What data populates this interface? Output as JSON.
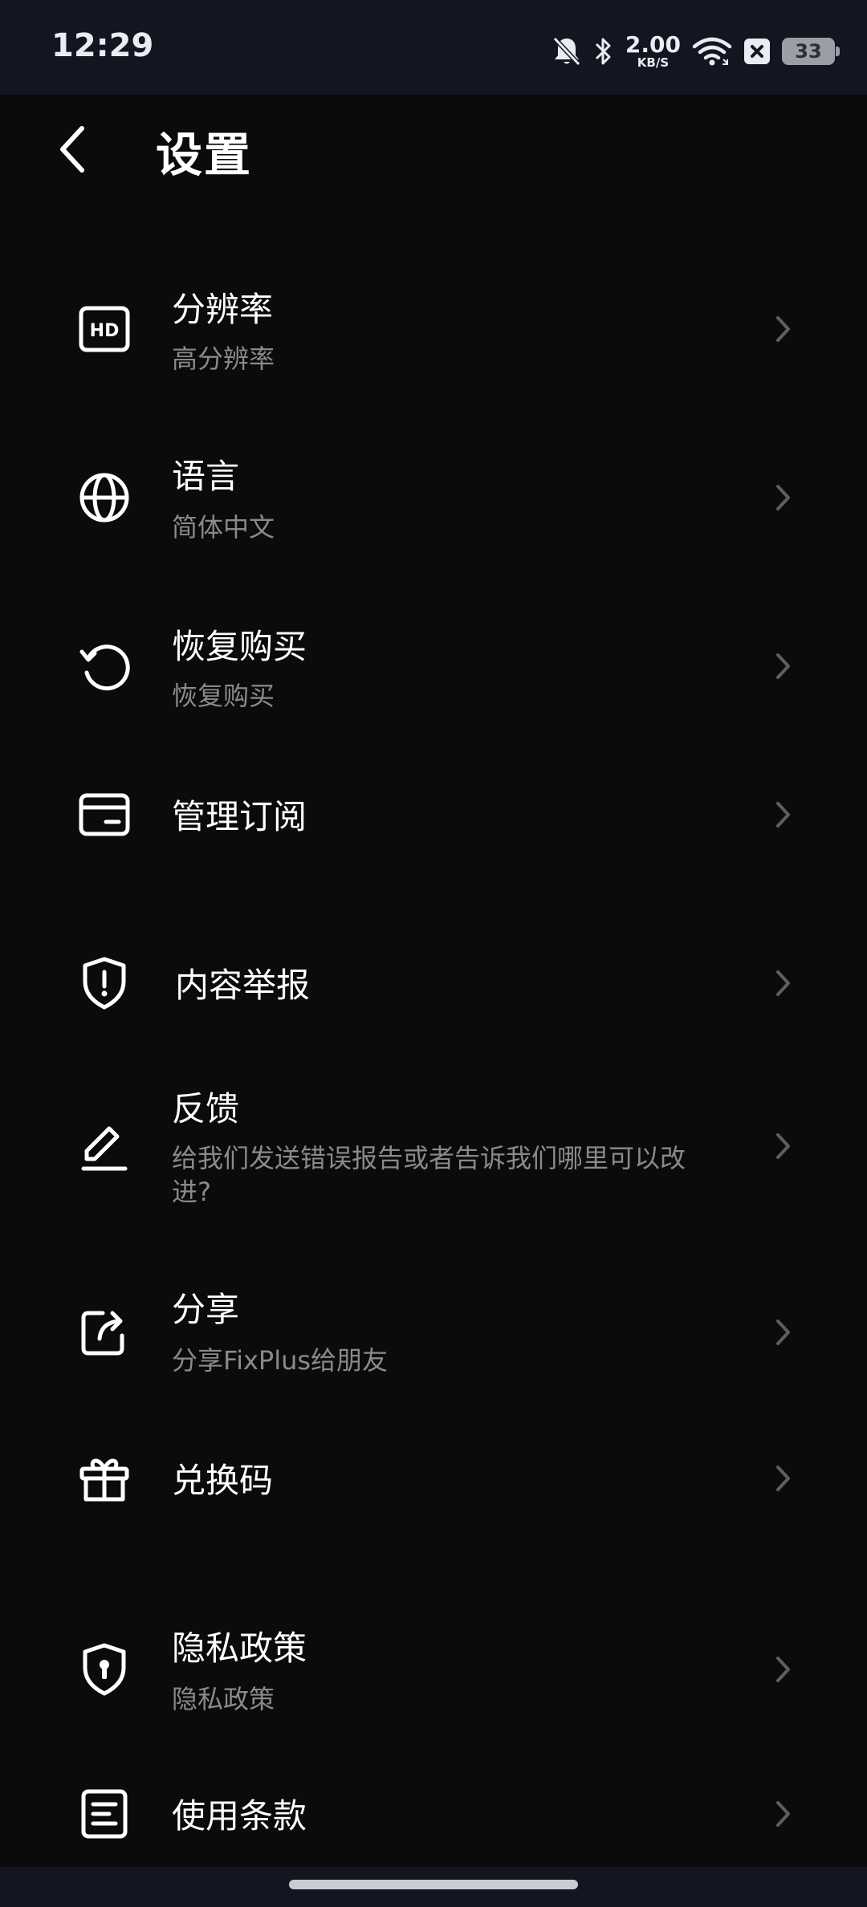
{
  "status_bar": {
    "time": "12:29",
    "net_speed_value": "2.00",
    "net_speed_unit": "KB/S",
    "battery_level": "33",
    "icons": [
      "bell-muted-icon",
      "bluetooth-icon",
      "wifi-icon",
      "close-box-icon",
      "battery-icon"
    ]
  },
  "header": {
    "title": "设置",
    "back_icon": "chevron-left-icon"
  },
  "settings": [
    {
      "label": "分辨率",
      "sub": "高分辨率",
      "icon": "hd-icon"
    },
    {
      "label": "语言",
      "sub": "简体中文",
      "icon": "globe-icon"
    },
    {
      "label": "恢复购买",
      "sub": "恢复购买",
      "icon": "restore-icon"
    },
    {
      "label": "管理订阅",
      "sub": "",
      "icon": "card-icon"
    },
    {
      "label": "内容举报",
      "sub": "",
      "icon": "shield-alert-icon"
    },
    {
      "label": "反馈",
      "sub": "给我们发送错误报告或者告诉我们哪里可以改进?",
      "icon": "pencil-icon"
    },
    {
      "label": "分享",
      "sub": "分享FixPlus给朋友",
      "icon": "share-icon"
    },
    {
      "label": "兑换码",
      "sub": "",
      "icon": "gift-icon"
    },
    {
      "label": "隐私政策",
      "sub": "隐私政策",
      "icon": "shield-lock-icon"
    },
    {
      "label": "使用条款",
      "sub": "",
      "icon": "document-icon"
    }
  ],
  "colors": {
    "background": "#0b0b0b",
    "status_bar": "#121620",
    "text_primary": "#ffffff",
    "text_secondary": "#8a8a8a",
    "chevron": "#5f5f5f"
  }
}
